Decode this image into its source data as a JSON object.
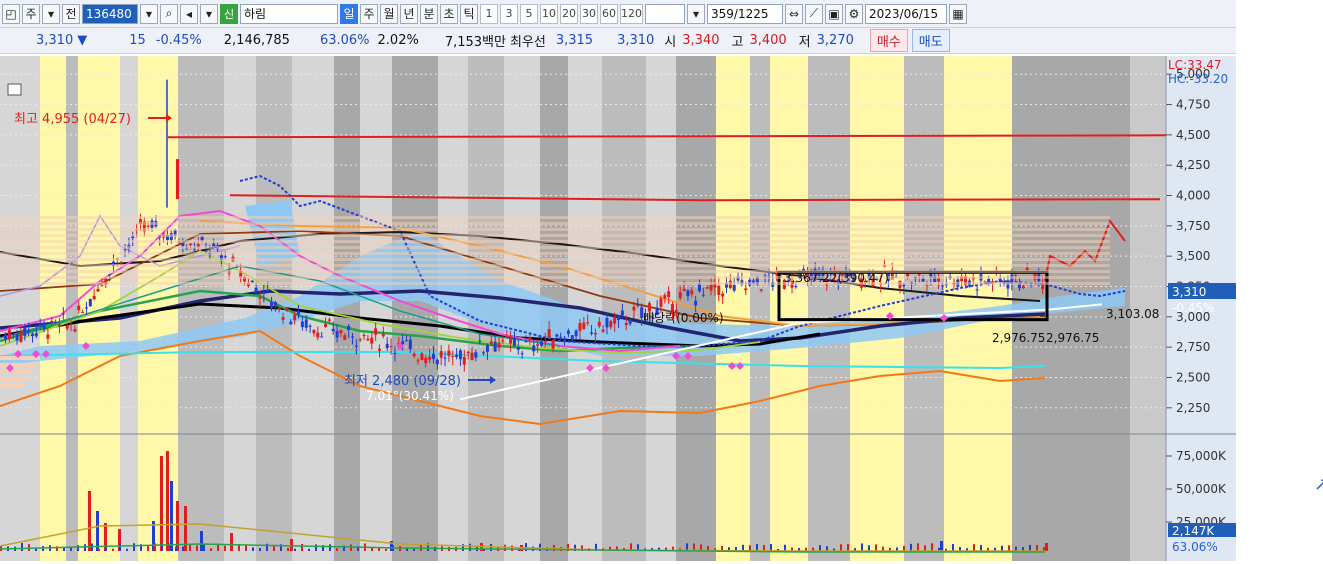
{
  "toolbar": {
    "type_label": "주",
    "prev_label": "전",
    "stock_code": "136480",
    "new_badge": "신",
    "stock_name": "하림",
    "periods": [
      "일",
      "주",
      "월",
      "년",
      "분",
      "초",
      "틱"
    ],
    "active_period": "일",
    "intervals": [
      "1",
      "3",
      "5",
      "10",
      "20",
      "30",
      "60",
      "120"
    ],
    "count": "359",
    "count_total": "/1225",
    "date": "2023/06/15"
  },
  "info": {
    "price": "3,310",
    "arrow": "▼",
    "change": "15",
    "change_pct": "-0.45%",
    "volume": "2,146,785",
    "turnover_pct": "63.06%",
    "pct2": "2.02%",
    "amount": "7,153백만",
    "best_ask_label": "최우선",
    "best_ask": "3,315",
    "best_bid": "3,310",
    "open_label": "시",
    "open": "3,340",
    "high_label": "고",
    "high": "3,400",
    "low_label": "저",
    "low": "3,270",
    "buy_label": "매수",
    "sell_label": "매도"
  },
  "axis": {
    "lc": "LC:33.47",
    "hc": "HC:-33.20",
    "price_ticks": [
      "5,000",
      "4,750",
      "4,500",
      "4,250",
      "4,000",
      "3,750",
      "3,500",
      "3,250",
      "3,000",
      "2,750",
      "2,500",
      "2,250"
    ],
    "volume_ticks": [
      "75,000K",
      "50,000K",
      "25,000K"
    ],
    "current_price": "3,310",
    "current_pct": "-0.45%",
    "current_volume": "2,147K",
    "current_volume_pct": "63.06%"
  },
  "annotations": {
    "high_label": "최고 4,955 (04/27)",
    "low_label": "최저 2,480 (09/28)",
    "trend_label": "7.01°(30.41%)",
    "box_label": "3,367.22(390.47)",
    "dividend_label": "배당락(0.00%)",
    "box_low_label": "2,976.75",
    "box_low_label2": "2,976.75",
    "support_label": "3,103.08"
  },
  "chart_data": {
    "type": "line",
    "title": "",
    "y_range": [
      2100,
      5150
    ],
    "x": [
      0,
      1,
      2,
      3,
      4,
      5,
      6,
      7,
      8,
      9,
      10,
      11,
      12,
      13,
      14,
      15,
      16,
      17,
      18,
      19,
      20,
      21,
      22,
      23,
      24,
      25,
      26,
      27,
      28,
      29,
      30
    ],
    "series": [
      {
        "values": [
          2850,
          2900,
          2950,
          3400,
          3750,
          3650,
          3550,
          3300,
          3050,
          2900,
          2850,
          2800,
          2700,
          2650,
          2800,
          2750,
          2850,
          2900,
          3000,
          3100,
          3200,
          3250,
          3300,
          3320,
          3330,
          3340,
          3310,
          3320,
          3300,
          3310,
          3310
        ],
        "color": "#1a1a8c"
      }
    ],
    "resistance": 4480,
    "overhead_resistance": 3920,
    "support_start": 2320,
    "support_end": 3103.08,
    "box_top": 3367.22,
    "box_bottom": 2976.75,
    "ylabel": ""
  }
}
